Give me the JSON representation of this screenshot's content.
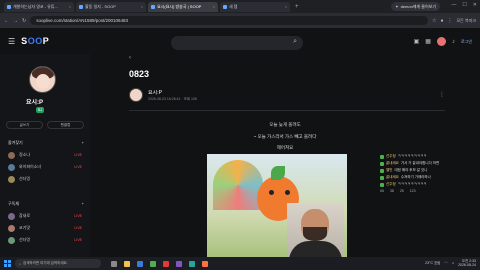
{
  "browser": {
    "tabs": [
      {
        "label": "개발하는남자 영코 - 유튜..."
      },
      {
        "label": "활동 일지 - SOOP"
      },
      {
        "label": "요시(요시) 방송국 | SOOP"
      },
      {
        "label": "새 탭"
      }
    ],
    "tab_extra": "demon에게 물어보기",
    "url": "sooplive.com/station/AN1589/post/200106483",
    "bookmark": "모든 북마크"
  },
  "header": {
    "logo_prefix": "S",
    "logo_accent": "OO",
    "logo_suffix": "P",
    "login_label": "로그인",
    "icons": [
      "menu-icon",
      "search-icon",
      "camera-icon",
      "grid-icon",
      "bell-icon",
      "avatar"
    ]
  },
  "sidebar": {
    "profile_name": "요시:P",
    "profile_badge": "BJ",
    "btn_write": "글쓰기",
    "btn_mypage": "팬클럽",
    "section1_title": "즐겨찾기",
    "section1_items": [
      {
        "name": "정소나",
        "badge": "LIVE"
      },
      {
        "name": "와이파이소녀",
        "badge": "LIVE"
      },
      {
        "name": "선더멍",
        "badge": ""
      }
    ],
    "section2_title": "구독채",
    "section2_items": [
      {
        "name": "참새로",
        "badge": "LIVE"
      },
      {
        "name": "코기맛",
        "badge": "LIVE"
      },
      {
        "name": "선더멍",
        "badge": "LIVE"
      }
    ]
  },
  "post": {
    "back_label": "‹",
    "title": "0823",
    "author": "요시:P",
    "meta": "2026-08-23 16:26:41 · 조회 105",
    "more_label": "⋮",
    "lines": [
      "오늘 늦게 올려도",
      "~ 오늘 가스라서 가스 빼고 올려다",
      "헤어져요"
    ]
  },
  "chat": {
    "messages": [
      {
        "nick": "선주정",
        "text": "ㅋㅋㅋㅋㅋㅋㅋㅋㅋ"
      },
      {
        "nick": "끝내세요",
        "text": "가서 거 끝내야합니다 하면"
      },
      {
        "nick": "엘빈",
        "text": "대청 해야 후보 갈 것니"
      },
      {
        "nick": "끝내세요",
        "text": "수져하기 가매라하나"
      },
      {
        "nick": "선주정",
        "text": "ㅋㅋㅋㅋㅋㅋㅋㅋㅋ"
      }
    ],
    "stats": [
      "65",
      "38",
      "25",
      "123"
    ]
  },
  "taskbar": {
    "search_placeholder": "검색하려면 여기에 입력하세요.",
    "temp": "23°C 흐림",
    "time": "오전 2:33",
    "date": "2026-08-24"
  }
}
